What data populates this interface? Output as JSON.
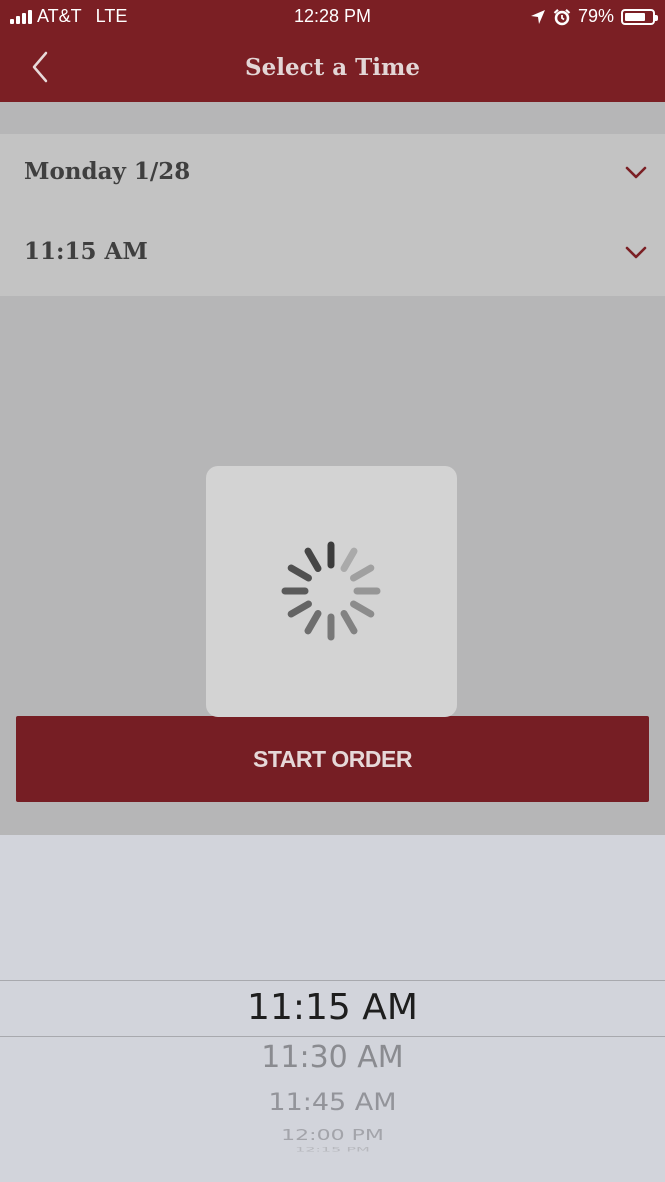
{
  "status_bar": {
    "carrier": "AT&T",
    "network": "LTE",
    "time": "12:28 PM",
    "battery_percent": "79%",
    "battery_level": 0.79,
    "icons": [
      "signal-bars-icon",
      "location-arrow-icon",
      "alarm-clock-icon",
      "battery-icon"
    ]
  },
  "nav": {
    "title": "Select a Time",
    "back_icon": "chevron-left-icon"
  },
  "selectors": {
    "date_label": "Monday 1/28",
    "time_label": "11:15 AM",
    "dropdown_icon": "chevron-down-icon"
  },
  "loading": {
    "icon": "spinner-icon"
  },
  "start_order_label": "START ORDER",
  "picker": {
    "selected": "11:15 AM",
    "options": [
      "11:30 AM",
      "11:45 AM",
      "12:00 PM",
      "12:15 PM"
    ]
  },
  "colors": {
    "brand": "#7b1f24",
    "button": "#761e24",
    "overlay_gray": "#b6b6b7",
    "picker_bg": "#d2d4db"
  }
}
